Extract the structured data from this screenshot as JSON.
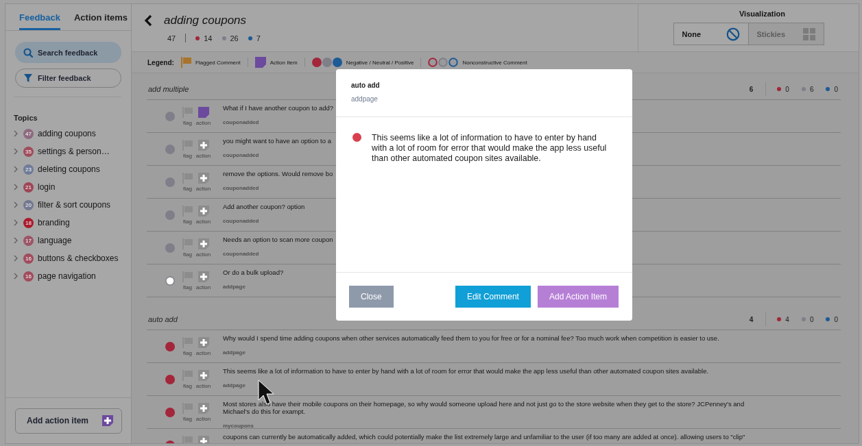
{
  "sidebar": {
    "tabs": [
      {
        "label": "Feedback",
        "selected": true
      },
      {
        "label": "Action items",
        "selected": false
      }
    ],
    "search": {
      "label": "Search feedback"
    },
    "filter": {
      "label": "Filter feedback"
    },
    "topics_heading": "Topics",
    "topics": [
      {
        "count": "47",
        "label": "adding coupons",
        "color": "#8d6a80"
      },
      {
        "count": "35",
        "label": "settings & person…",
        "color": "#a04d5c"
      },
      {
        "count": "23",
        "label": "deleting coupons",
        "color": "#6f7b98"
      },
      {
        "count": "21",
        "label": "login",
        "color": "#9e4556"
      },
      {
        "count": "20",
        "label": "filter & sort coupons",
        "color": "#737890"
      },
      {
        "count": "18",
        "label": "branding",
        "color": "#a81c2e"
      },
      {
        "count": "17",
        "label": "language",
        "color": "#9c5566"
      },
      {
        "count": "16",
        "label": "buttons & checkboxes",
        "color": "#a14c5e"
      },
      {
        "count": "16",
        "label": "page navigation",
        "color": "#a14c5e"
      }
    ],
    "add_action_button": "Add action item"
  },
  "header": {
    "title": "adding coupons",
    "total": "47",
    "counts": [
      {
        "value": "14",
        "color": "#a3263a"
      },
      {
        "value": "26",
        "color": "#7f7f8a"
      },
      {
        "value": "7",
        "color": "#1d5a96"
      }
    ]
  },
  "visualization": {
    "label": "Visualization",
    "options": [
      {
        "label": "None",
        "kind": "none",
        "selected": true
      },
      {
        "label": "Stickies",
        "kind": "stickies",
        "selected": false
      }
    ]
  },
  "legend": {
    "label": "Legend:",
    "items": [
      {
        "kind": "flag",
        "label": "Flagged Comment"
      },
      {
        "kind": "action",
        "label": "Action Item"
      },
      {
        "kind": "sentiment",
        "label": "Negative / Neutral / Positive"
      },
      {
        "kind": "nonconstructive",
        "label": "Nonconstructive Comment"
      }
    ]
  },
  "groups": [
    {
      "name": "add multiple",
      "total": "6",
      "counts": [
        {
          "value": "0",
          "color": "#a3263a"
        },
        {
          "value": "6",
          "color": "#7f7f8a"
        },
        {
          "value": "0",
          "color": "#1d5a96"
        }
      ],
      "rows": [
        {
          "color": "#7f7f8a",
          "hollow": false,
          "flagged": false,
          "has_action": true,
          "flag_label": "flag",
          "action_label": "action",
          "text": "What if I have another coupon to add?",
          "page": "couponadded"
        },
        {
          "color": "#7f7f8a",
          "hollow": false,
          "flagged": false,
          "has_action": false,
          "flag_label": "flag",
          "action_label": "action",
          "text": "you might want to have an option to a",
          "page": "couponadded"
        },
        {
          "color": "#7f7f8a",
          "hollow": false,
          "flagged": false,
          "has_action": false,
          "flag_label": "flag",
          "action_label": "action",
          "text": "remove the options. Would remove bo",
          "page": "couponadded"
        },
        {
          "color": "#7f7f8a",
          "hollow": false,
          "flagged": false,
          "has_action": false,
          "flag_label": "flag",
          "action_label": "action",
          "text": "Add another coupon? option",
          "page": "couponadded"
        },
        {
          "color": "#7f7f8a",
          "hollow": false,
          "flagged": false,
          "has_action": false,
          "flag_label": "flag",
          "action_label": "action",
          "text": "Needs an option to scan more coupon",
          "page": "couponadded"
        },
        {
          "color": "#7f7f8a",
          "hollow": true,
          "flagged": false,
          "has_action": false,
          "flag_label": "flag",
          "action_label": "action",
          "text": "Or do a bulk upload?",
          "page": "addpage"
        }
      ]
    },
    {
      "name": "auto add",
      "total": "4",
      "counts": [
        {
          "value": "4",
          "color": "#a3263a"
        },
        {
          "value": "0",
          "color": "#7f7f8a"
        },
        {
          "value": "0",
          "color": "#1d5a96"
        }
      ],
      "rows": [
        {
          "color": "#a3263a",
          "hollow": false,
          "flagged": false,
          "has_action": false,
          "flag_label": "flag",
          "action_label": "action",
          "text": "Why would I spend time adding coupons when other services automatically feed them to you for free or for a nominal fee? Too much work when competition is easier to use.",
          "page": "addpage"
        },
        {
          "color": "#a3263a",
          "hollow": false,
          "flagged": false,
          "has_action": false,
          "flag_label": "flag",
          "action_label": "action",
          "text": "This seems like a lot of information to have to enter by hand with a lot of room for error that would make the app less useful than other automated coupon sites available.",
          "page": "addpage"
        },
        {
          "color": "#a3263a",
          "hollow": false,
          "flagged": false,
          "has_action": false,
          "flag_label": "flag",
          "action_label": "action",
          "text": "Most stores also have their mobile coupons on their homepage, so why would someone upload here and not just go to the store website when they get to the store? JCPenney's and Michael's do this for exampt.",
          "page": "mycoupons"
        },
        {
          "color": "#a3263a",
          "hollow": false,
          "flagged": false,
          "has_action": false,
          "text": "coupons can currently be automatically added, which could potentially make the list extremely large and unfamiliar to the user (if too many are added at once). allowing users to \"clip\""
        }
      ]
    }
  ],
  "modal": {
    "title": "auto add",
    "subtitle": "addpage",
    "comment": {
      "color": "#d9404f",
      "text": "This seems like a lot of information to have to enter by hand with a lot of room for error that would make the app less useful than other automated coupon sites available."
    },
    "buttons": [
      {
        "label": "Close",
        "kind": "secondary"
      },
      {
        "label": "Edit Comment",
        "kind": "primary"
      },
      {
        "label": "Add Action Item",
        "kind": "action"
      }
    ]
  }
}
